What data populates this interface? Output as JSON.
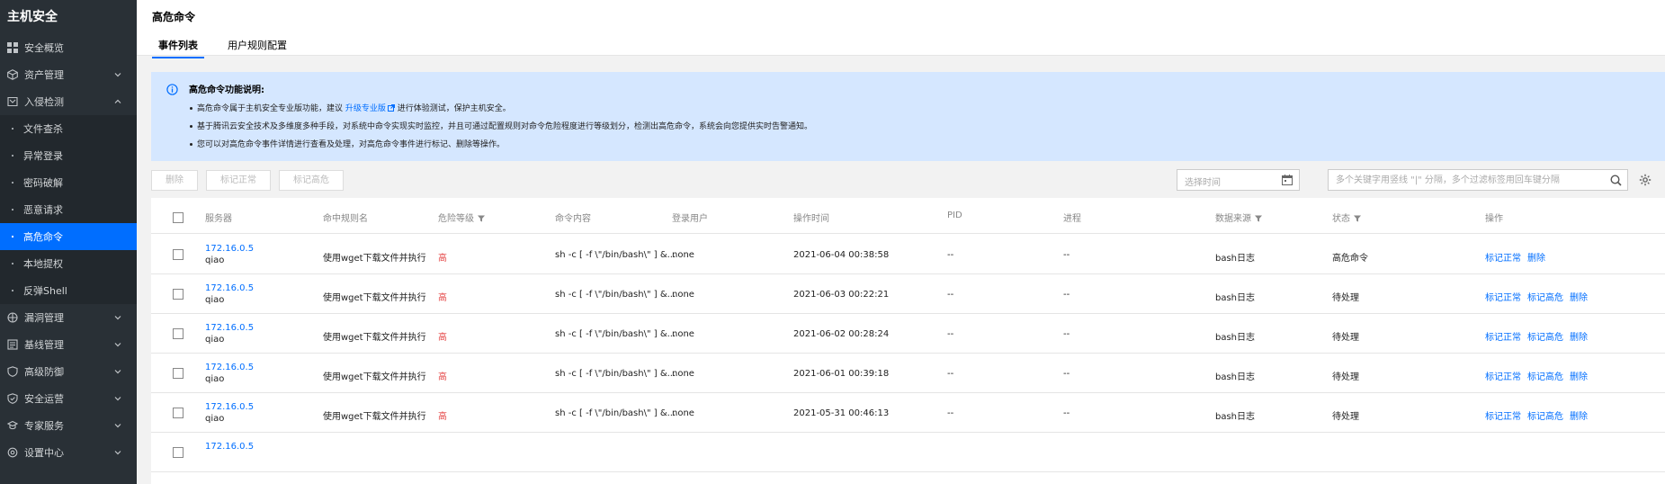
{
  "sidebar": {
    "title": "主机安全",
    "items": [
      {
        "label": "安全概览",
        "icon": "grid-icon",
        "chevron": "",
        "subs": []
      },
      {
        "label": "资产管理",
        "icon": "cube-icon",
        "chevron": "down",
        "subs": []
      },
      {
        "label": "入侵检测",
        "icon": "shield-alert-icon",
        "chevron": "up",
        "subs": [
          {
            "label": "文件查杀",
            "active": false
          },
          {
            "label": "异常登录",
            "active": false
          },
          {
            "label": "密码破解",
            "active": false
          },
          {
            "label": "恶意请求",
            "active": false
          },
          {
            "label": "高危命令",
            "active": true
          },
          {
            "label": "本地提权",
            "active": false
          },
          {
            "label": "反弹Shell",
            "active": false
          }
        ]
      },
      {
        "label": "漏洞管理",
        "icon": "bug-icon",
        "chevron": "down",
        "subs": []
      },
      {
        "label": "基线管理",
        "icon": "checklist-icon",
        "chevron": "down",
        "subs": []
      },
      {
        "label": "高级防御",
        "icon": "shield-icon",
        "chevron": "down",
        "subs": []
      },
      {
        "label": "安全运营",
        "icon": "shield-check-icon",
        "chevron": "down",
        "subs": []
      },
      {
        "label": "专家服务",
        "icon": "expert-icon",
        "chevron": "down",
        "subs": []
      },
      {
        "label": "设置中心",
        "icon": "gear-icon",
        "chevron": "down",
        "subs": []
      }
    ]
  },
  "header": {
    "title": "高危命令",
    "tabs": [
      "事件列表",
      "用户规则配置"
    ]
  },
  "notice": {
    "title": "高危命令功能说明:",
    "line1_prefix": "高危命令属于主机安全专业版功能，建议",
    "line1_link": "升级专业版",
    "line1_suffix": "进行体验测试，保护主机安全。",
    "line2": "基于腾讯云安全技术及多维度多种手段，对系统中命令实现实时监控，并且可通过配置规则对命令危险程度进行等级划分，检测出高危命令，系统会向您提供实时告警通知。",
    "line3": "您可以对高危命令事件详情进行查看及处理，对高危命令事件进行标记、删除等操作。"
  },
  "toolbar": {
    "delete_label": "删除",
    "mark_normal_label": "标记正常",
    "mark_high_label": "标记高危",
    "date_placeholder": "选择时间",
    "search_placeholder": "多个关键字用竖线 \"|\" 分隔，多个过滤标签用回车键分隔"
  },
  "table": {
    "columns": {
      "server": "服务器",
      "rule": "命中规则名",
      "risk": "危险等级",
      "cmd": "命令内容",
      "user": "登录用户",
      "time": "操作时间",
      "pid": "PID",
      "process": "进程",
      "source": "数据来源",
      "status": "状态",
      "ops": "操作"
    },
    "rows": [
      {
        "ip": "172.16.0.5",
        "host": "qiao",
        "rule": "使用wget下载文件并执行",
        "risk": "高",
        "cmd": "sh -c [ -f \\\"/bin/bash\\\" ] &...",
        "user": "none",
        "time": "2021-06-04 00:38:58",
        "pid": "--",
        "process": "--",
        "source": "bash日志",
        "status": "高危命令",
        "ops": [
          "标记正常",
          "删除"
        ]
      },
      {
        "ip": "172.16.0.5",
        "host": "qiao",
        "rule": "使用wget下载文件并执行",
        "risk": "高",
        "cmd": "sh -c [ -f \\\"/bin/bash\\\" ] &...",
        "user": "none",
        "time": "2021-06-03 00:22:21",
        "pid": "--",
        "process": "--",
        "source": "bash日志",
        "status": "待处理",
        "ops": [
          "标记正常",
          "标记高危",
          "删除"
        ]
      },
      {
        "ip": "172.16.0.5",
        "host": "qiao",
        "rule": "使用wget下载文件并执行",
        "risk": "高",
        "cmd": "sh -c [ -f \\\"/bin/bash\\\" ] &...",
        "user": "none",
        "time": "2021-06-02 00:28:24",
        "pid": "--",
        "process": "--",
        "source": "bash日志",
        "status": "待处理",
        "ops": [
          "标记正常",
          "标记高危",
          "删除"
        ]
      },
      {
        "ip": "172.16.0.5",
        "host": "qiao",
        "rule": "使用wget下载文件并执行",
        "risk": "高",
        "cmd": "sh -c [ -f \\\"/bin/bash\\\" ] &...",
        "user": "none",
        "time": "2021-06-01 00:39:18",
        "pid": "--",
        "process": "--",
        "source": "bash日志",
        "status": "待处理",
        "ops": [
          "标记正常",
          "标记高危",
          "删除"
        ]
      },
      {
        "ip": "172.16.0.5",
        "host": "qiao",
        "rule": "使用wget下载文件并执行",
        "risk": "高",
        "cmd": "sh -c [ -f \\\"/bin/bash\\\" ] &...",
        "user": "none",
        "time": "2021-05-31 00:46:13",
        "pid": "--",
        "process": "--",
        "source": "bash日志",
        "status": "待处理",
        "ops": [
          "标记正常",
          "标记高危",
          "删除"
        ]
      },
      {
        "ip": "172.16.0.5",
        "host": "",
        "rule": "",
        "risk": "",
        "cmd": "",
        "user": "",
        "time": "",
        "pid": "",
        "process": "",
        "source": "",
        "status": "",
        "ops": []
      }
    ]
  },
  "colors": {
    "sidebar_bg": "#293036",
    "accent": "#006eff",
    "notice_bg": "#d5e7ff",
    "risk_high": "#e54545"
  }
}
